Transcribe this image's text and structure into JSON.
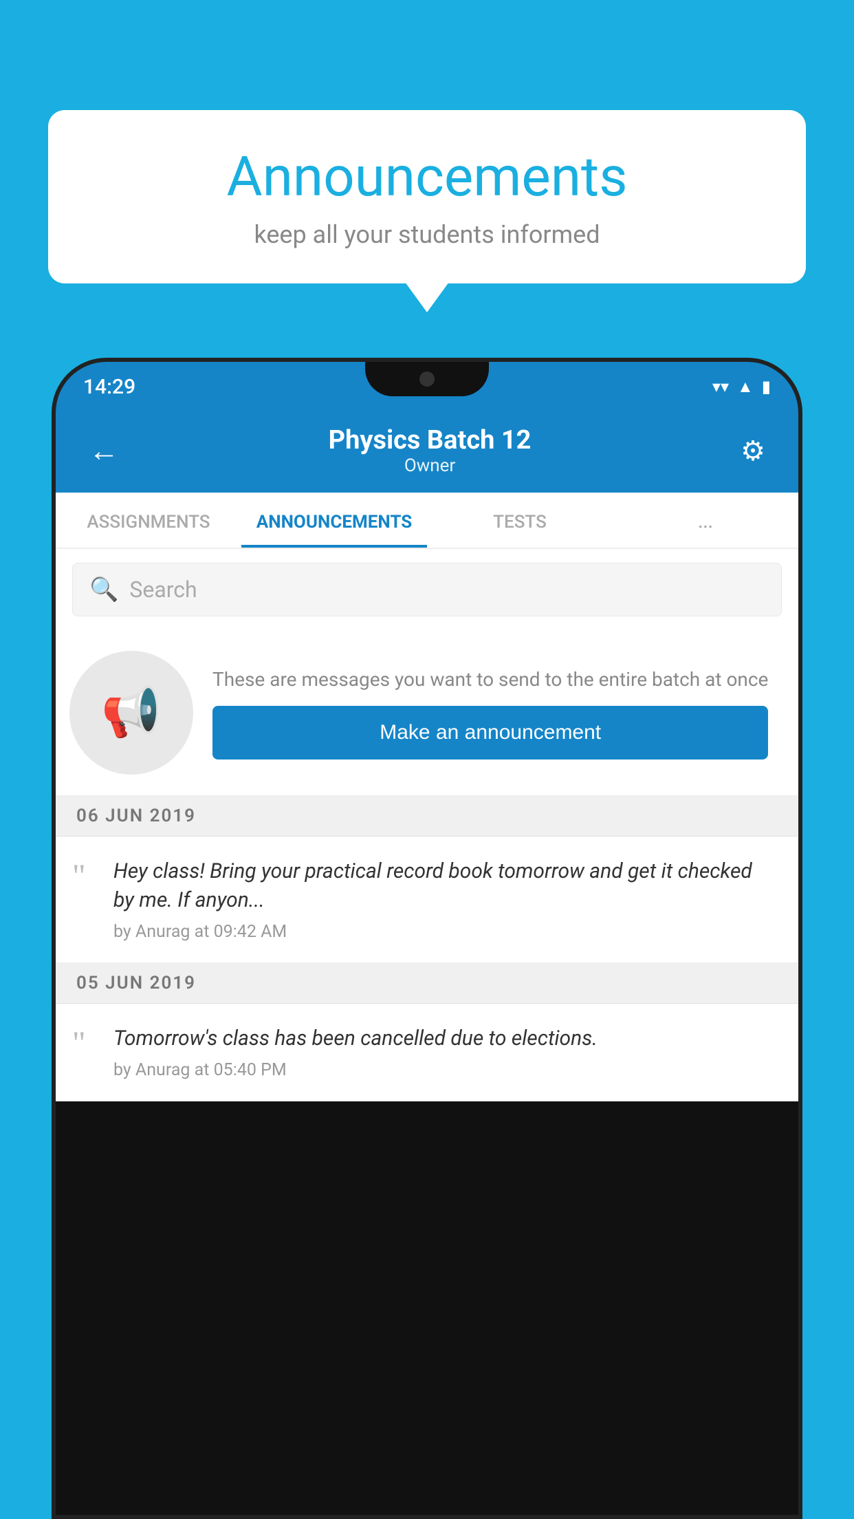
{
  "background": {
    "color": "#1AAFE0"
  },
  "speech_bubble": {
    "title": "Announcements",
    "subtitle": "keep all your students informed"
  },
  "status_bar": {
    "time": "14:29",
    "icons": [
      "wifi",
      "signal",
      "battery"
    ]
  },
  "app_header": {
    "back_label": "←",
    "title": "Physics Batch 12",
    "subtitle": "Owner",
    "settings_label": "⚙"
  },
  "tabs": [
    {
      "label": "ASSIGNMENTS",
      "active": false
    },
    {
      "label": "ANNOUNCEMENTS",
      "active": true
    },
    {
      "label": "TESTS",
      "active": false
    },
    {
      "label": "...",
      "active": false
    }
  ],
  "search": {
    "placeholder": "Search"
  },
  "announcement_promo": {
    "description": "These are messages you want to send to the entire batch at once",
    "button_label": "Make an announcement"
  },
  "announcements": [
    {
      "date": "06  JUN  2019",
      "items": [
        {
          "text": "Hey class! Bring your practical record book tomorrow and get it checked by me. If anyon...",
          "meta": "by Anurag at 09:42 AM"
        }
      ]
    },
    {
      "date": "05  JUN  2019",
      "items": [
        {
          "text": "Tomorrow's class has been cancelled due to elections.",
          "meta": "by Anurag at 05:40 PM"
        }
      ]
    }
  ]
}
